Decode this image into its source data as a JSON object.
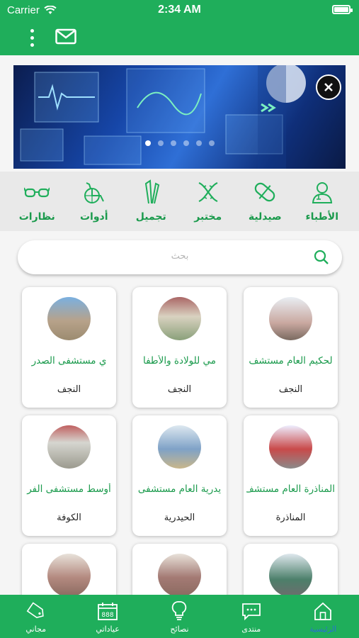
{
  "status": {
    "carrier": "Carrier",
    "time": "2:34 AM"
  },
  "categories": [
    {
      "label": "الأطباء",
      "icon": "doctor-icon"
    },
    {
      "label": "صيدلية",
      "icon": "pill-icon"
    },
    {
      "label": "مختبر",
      "icon": "dna-icon"
    },
    {
      "label": "تجميل",
      "icon": "beauty-icon"
    },
    {
      "label": "أدوات",
      "icon": "wheelchair-icon"
    },
    {
      "label": "نظارات",
      "icon": "glasses-icon"
    }
  ],
  "search": {
    "placeholder": "بحث"
  },
  "cards": [
    {
      "name": "لحكيم العام مستشف",
      "city": "النجف",
      "img": "#c9a8a0"
    },
    {
      "name": "مي للولادة والأطفا",
      "city": "النجف",
      "img": "#8aa07a"
    },
    {
      "name": "ي مستشفى الصدر",
      "city": "النجف",
      "img": "#b7a28a"
    },
    {
      "name": "المناذرة العام مستشف",
      "city": "المناذرة",
      "img": "#c94a4a"
    },
    {
      "name": "يدرية العام مستشفى",
      "city": "الحيدرية",
      "img": "#7fa2c7"
    },
    {
      "name": "أوسط مستشفى الفر",
      "city": "الكوفة",
      "img": "#9b9a8e"
    },
    {
      "name": "",
      "city": "",
      "img": "#4c7f6a"
    },
    {
      "name": "",
      "city": "",
      "img": "#a47a74"
    },
    {
      "name": "",
      "city": "",
      "img": "#b48a80"
    }
  ],
  "tabs": [
    {
      "label": "الرئيسية",
      "icon": "home-icon",
      "active": true
    },
    {
      "label": "منتدى",
      "icon": "chat-icon",
      "active": false
    },
    {
      "label": "نصائح",
      "icon": "lightbulb-icon",
      "active": false
    },
    {
      "label": "عياداتي",
      "icon": "calendar-icon",
      "active": false
    },
    {
      "label": "مجاني",
      "icon": "tag-icon",
      "active": false
    }
  ],
  "colors": {
    "primary": "#1fae5b",
    "accent_text": "#1a9a4c",
    "active_tab": "#2a6fd6"
  }
}
